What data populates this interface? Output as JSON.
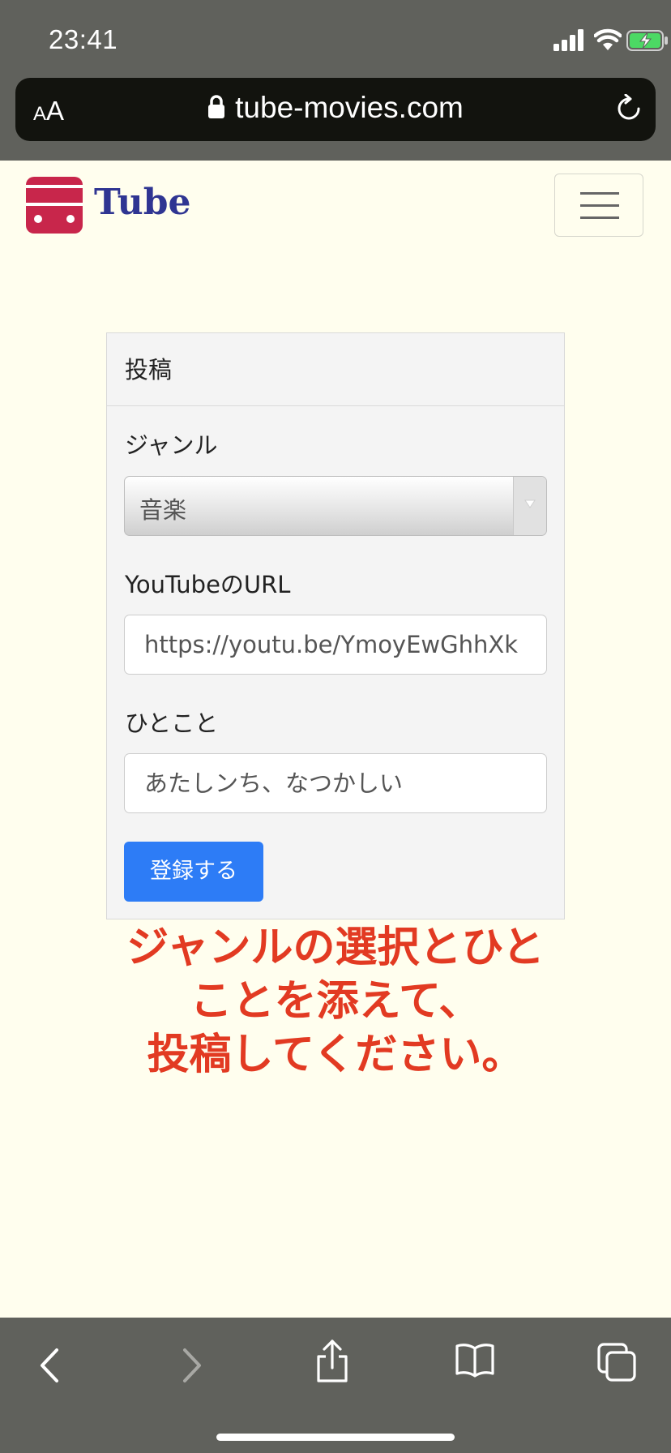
{
  "status_bar": {
    "time": "23:41"
  },
  "browser": {
    "text_size_label_small": "A",
    "text_size_label_big": "A",
    "url": "tube-movies.com"
  },
  "site": {
    "brand": "Tube",
    "brand_color": "#2f3592",
    "logo_color": "#c8264b"
  },
  "form": {
    "header": "投稿",
    "genre_label": "ジャンル",
    "genre_value": "音楽",
    "url_label": "YouTubeのURL",
    "url_value": "https://youtu.be/YmoyEwGhhXk",
    "comment_label": "ひとこと",
    "comment_value": "あたしンち、なつかしい",
    "submit_label": "登録する",
    "submit_color": "#2d7cf6"
  },
  "note": {
    "line1": "ジャンルの選択とひと",
    "line2": "ことを添えて、",
    "line3": "投稿してください。",
    "color": "#e23a22"
  },
  "toolbar": {
    "icons": [
      "back-icon",
      "forward-icon",
      "share-icon",
      "bookmarks-icon",
      "tabs-icon"
    ]
  }
}
